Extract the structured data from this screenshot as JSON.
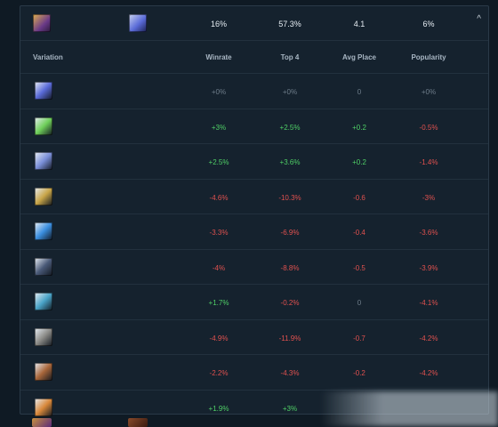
{
  "header": {
    "winrate": "16%",
    "top4": "57.3%",
    "avg_place": "4.1",
    "popularity": "6%",
    "chevron": "^",
    "champion_icon": "champion-portrait-icon",
    "item_icon": "winged-blade-item-icon"
  },
  "columns": {
    "variation": "Variation",
    "winrate": "Winrate",
    "top4": "Top 4",
    "avg_place": "Avg Place",
    "popularity": "Popularity"
  },
  "rows": [
    {
      "icon": "winged-blade-item-icon",
      "color": "#5a6bd8",
      "winrate": "+0%",
      "top4": "+0%",
      "avg_place": "0",
      "popularity": "+0%",
      "tones": [
        "neu",
        "neu",
        "neu",
        "neu"
      ]
    },
    {
      "icon": "green-slash-item-icon",
      "color": "#6fcf5a",
      "winrate": "+3%",
      "top4": "+2.5%",
      "avg_place": "+0.2",
      "popularity": "-0.5%",
      "tones": [
        "pos",
        "pos",
        "pos",
        "neg"
      ]
    },
    {
      "icon": "crystal-orb-item-icon",
      "color": "#7a8fd8",
      "winrate": "+2.5%",
      "top4": "+3.6%",
      "avg_place": "+0.2",
      "popularity": "-1.4%",
      "tones": [
        "pos",
        "pos",
        "pos",
        "neg"
      ]
    },
    {
      "icon": "golden-claw-item-icon",
      "color": "#c8a548",
      "winrate": "-4.6%",
      "top4": "-10.3%",
      "avg_place": "-0.6",
      "popularity": "-3%",
      "tones": [
        "neg",
        "neg",
        "neg",
        "neg"
      ]
    },
    {
      "icon": "blue-sphere-item-icon",
      "color": "#3b8fe0",
      "winrate": "-3.3%",
      "top4": "-6.9%",
      "avg_place": "-0.4",
      "popularity": "-3.6%",
      "tones": [
        "neg",
        "neg",
        "neg",
        "neg"
      ]
    },
    {
      "icon": "dark-relic-item-icon",
      "color": "#4a5a78",
      "winrate": "-4%",
      "top4": "-8.8%",
      "avg_place": "-0.5",
      "popularity": "-3.9%",
      "tones": [
        "neg",
        "neg",
        "neg",
        "neg"
      ]
    },
    {
      "icon": "ice-gauntlet-item-icon",
      "color": "#4aa4c8",
      "winrate": "+1.7%",
      "top4": "-0.2%",
      "avg_place": "0",
      "popularity": "-4.1%",
      "tones": [
        "pos",
        "neg",
        "neu",
        "neg"
      ]
    },
    {
      "icon": "stone-helm-item-icon",
      "color": "#8a8a86",
      "winrate": "-4.9%",
      "top4": "-11.9%",
      "avg_place": "-0.7",
      "popularity": "-4.2%",
      "tones": [
        "neg",
        "neg",
        "neg",
        "neg"
      ]
    },
    {
      "icon": "bronze-chest-item-icon",
      "color": "#a8663a",
      "winrate": "-2.2%",
      "top4": "-4.3%",
      "avg_place": "-0.2",
      "popularity": "-4.2%",
      "tones": [
        "neg",
        "neg",
        "neg",
        "neg"
      ]
    },
    {
      "icon": "flame-crest-item-icon",
      "color": "#d8883a",
      "winrate": "+1.9%",
      "top4": "+3%",
      "avg_place": "",
      "popularity": "",
      "tones": [
        "pos",
        "pos",
        "neu",
        "neu"
      ]
    }
  ],
  "colors": {
    "positive": "#4fcf66",
    "negative": "#e0514f",
    "neutral": "#6e7d8a"
  }
}
